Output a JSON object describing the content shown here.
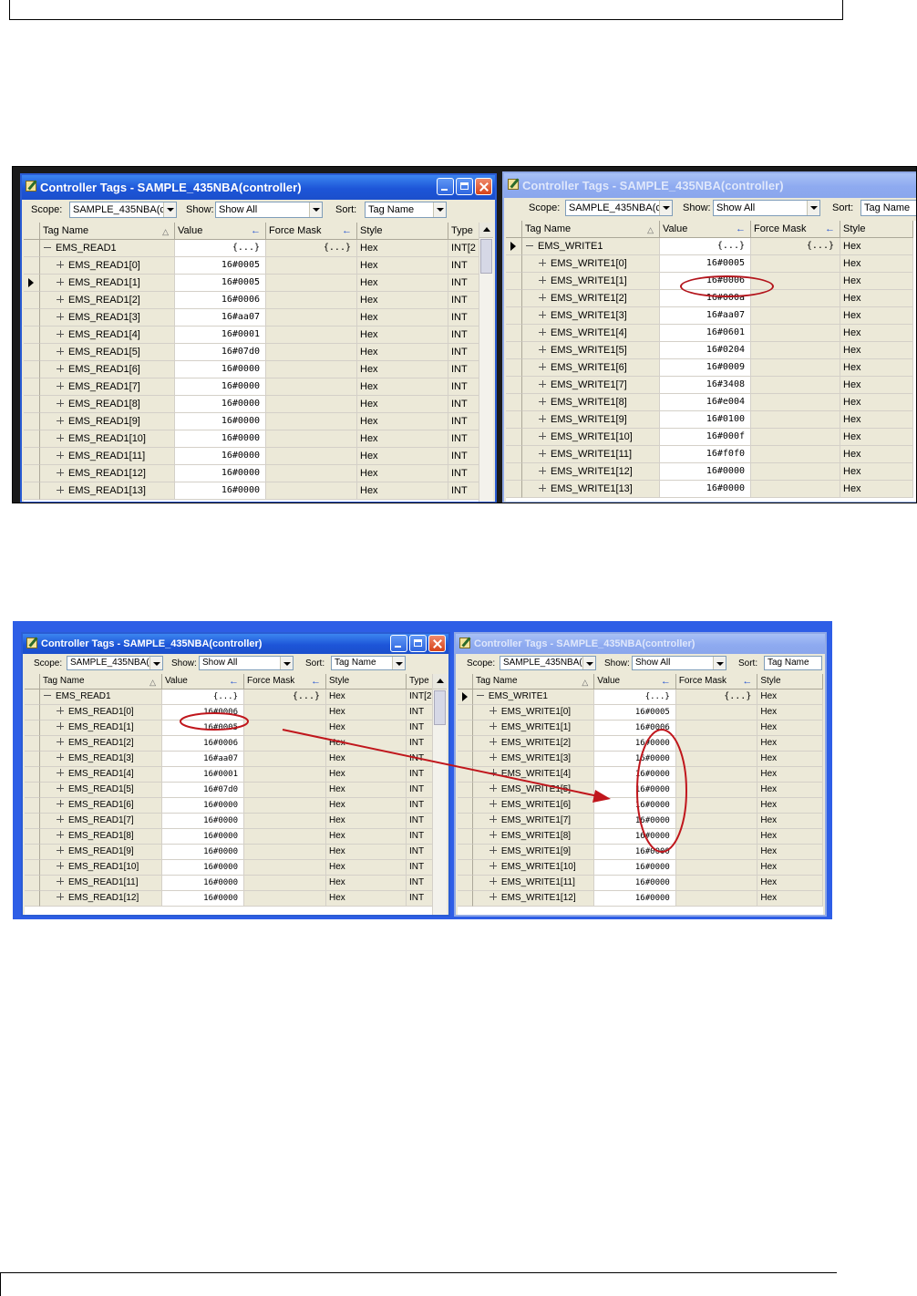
{
  "screens": [
    {
      "left_window": {
        "title": "Controller Tags - SAMPLE_435NBA(controller)",
        "toolbar": {
          "scope_label": "Scope:",
          "scope_value": "SAMPLE_435NBA(c",
          "show_label": "Show:",
          "show_value": "Show All",
          "sort_label": "Sort:",
          "sort_value": "Tag Name"
        },
        "columns": [
          "Tag Name",
          "Value",
          "Force Mask",
          "Style",
          "Type"
        ],
        "rows": [
          {
            "tag": "EMS_READ1",
            "value": "{...}",
            "force": "{...}",
            "style": "Hex",
            "type": "INT[2",
            "expanded": true
          },
          {
            "tag": "EMS_READ1[0]",
            "value": "16#0005",
            "force": "",
            "style": "Hex",
            "type": "INT"
          },
          {
            "tag": "EMS_READ1[1]",
            "value": "16#0005",
            "force": "",
            "style": "Hex",
            "type": "INT",
            "pointer": true
          },
          {
            "tag": "EMS_READ1[2]",
            "value": "16#0006",
            "force": "",
            "style": "Hex",
            "type": "INT"
          },
          {
            "tag": "EMS_READ1[3]",
            "value": "16#aa07",
            "force": "",
            "style": "Hex",
            "type": "INT"
          },
          {
            "tag": "EMS_READ1[4]",
            "value": "16#0001",
            "force": "",
            "style": "Hex",
            "type": "INT"
          },
          {
            "tag": "EMS_READ1[5]",
            "value": "16#07d0",
            "force": "",
            "style": "Hex",
            "type": "INT"
          },
          {
            "tag": "EMS_READ1[6]",
            "value": "16#0000",
            "force": "",
            "style": "Hex",
            "type": "INT"
          },
          {
            "tag": "EMS_READ1[7]",
            "value": "16#0000",
            "force": "",
            "style": "Hex",
            "type": "INT"
          },
          {
            "tag": "EMS_READ1[8]",
            "value": "16#0000",
            "force": "",
            "style": "Hex",
            "type": "INT"
          },
          {
            "tag": "EMS_READ1[9]",
            "value": "16#0000",
            "force": "",
            "style": "Hex",
            "type": "INT"
          },
          {
            "tag": "EMS_READ1[10]",
            "value": "16#0000",
            "force": "",
            "style": "Hex",
            "type": "INT"
          },
          {
            "tag": "EMS_READ1[11]",
            "value": "16#0000",
            "force": "",
            "style": "Hex",
            "type": "INT"
          },
          {
            "tag": "EMS_READ1[12]",
            "value": "16#0000",
            "force": "",
            "style": "Hex",
            "type": "INT"
          },
          {
            "tag": "EMS_READ1[13]",
            "value": "16#0000",
            "force": "",
            "style": "Hex",
            "type": "INT"
          }
        ]
      },
      "right_window": {
        "title": "Controller Tags - SAMPLE_435NBA(controller)",
        "toolbar": {
          "scope_label": "Scope:",
          "scope_value": "SAMPLE_435NBA(c",
          "show_label": "Show:",
          "show_value": "Show All",
          "sort_label": "Sort:",
          "sort_value": "Tag Name"
        },
        "columns": [
          "Tag Name",
          "Value",
          "Force Mask",
          "Style"
        ],
        "rows": [
          {
            "tag": "EMS_WRITE1",
            "value": "{...}",
            "force": "{...}",
            "style": "Hex",
            "expanded": true,
            "pointer": true
          },
          {
            "tag": "EMS_WRITE1[0]",
            "value": "16#0005",
            "force": "",
            "style": "Hex"
          },
          {
            "tag": "EMS_WRITE1[1]",
            "value": "16#0006",
            "force": "",
            "style": "Hex"
          },
          {
            "tag": "EMS_WRITE1[2]",
            "value": "16#000a",
            "force": "",
            "style": "Hex"
          },
          {
            "tag": "EMS_WRITE1[3]",
            "value": "16#aa07",
            "force": "",
            "style": "Hex"
          },
          {
            "tag": "EMS_WRITE1[4]",
            "value": "16#0601",
            "force": "",
            "style": "Hex"
          },
          {
            "tag": "EMS_WRITE1[5]",
            "value": "16#0204",
            "force": "",
            "style": "Hex"
          },
          {
            "tag": "EMS_WRITE1[6]",
            "value": "16#0009",
            "force": "",
            "style": "Hex"
          },
          {
            "tag": "EMS_WRITE1[7]",
            "value": "16#3408",
            "force": "",
            "style": "Hex"
          },
          {
            "tag": "EMS_WRITE1[8]",
            "value": "16#e004",
            "force": "",
            "style": "Hex"
          },
          {
            "tag": "EMS_WRITE1[9]",
            "value": "16#0100",
            "force": "",
            "style": "Hex"
          },
          {
            "tag": "EMS_WRITE1[10]",
            "value": "16#000f",
            "force": "",
            "style": "Hex"
          },
          {
            "tag": "EMS_WRITE1[11]",
            "value": "16#f0f0",
            "force": "",
            "style": "Hex"
          },
          {
            "tag": "EMS_WRITE1[12]",
            "value": "16#0000",
            "force": "",
            "style": "Hex"
          },
          {
            "tag": "EMS_WRITE1[13]",
            "value": "16#0000",
            "force": "",
            "style": "Hex"
          }
        ]
      }
    },
    {
      "left_window": {
        "title": "Controller Tags - SAMPLE_435NBA(controller)",
        "toolbar": {
          "scope_label": "Scope:",
          "scope_value": "SAMPLE_435NBA(c",
          "show_label": "Show:",
          "show_value": "Show All",
          "sort_label": "Sort:",
          "sort_value": "Tag Name"
        },
        "columns": [
          "Tag Name",
          "Value",
          "Force Mask",
          "Style",
          "Type"
        ],
        "rows": [
          {
            "tag": "EMS_READ1",
            "value": "{...}",
            "force": "{...}",
            "style": "Hex",
            "type": "INT[2",
            "expanded": true
          },
          {
            "tag": "EMS_READ1[0]",
            "value": "16#0006",
            "force": "",
            "style": "Hex",
            "type": "INT"
          },
          {
            "tag": "EMS_READ1[1]",
            "value": "16#0005",
            "force": "",
            "style": "Hex",
            "type": "INT"
          },
          {
            "tag": "EMS_READ1[2]",
            "value": "16#0006",
            "force": "",
            "style": "Hex",
            "type": "INT"
          },
          {
            "tag": "EMS_READ1[3]",
            "value": "16#aa07",
            "force": "",
            "style": "Hex",
            "type": "INT"
          },
          {
            "tag": "EMS_READ1[4]",
            "value": "16#0001",
            "force": "",
            "style": "Hex",
            "type": "INT"
          },
          {
            "tag": "EMS_READ1[5]",
            "value": "16#07d0",
            "force": "",
            "style": "Hex",
            "type": "INT"
          },
          {
            "tag": "EMS_READ1[6]",
            "value": "16#0000",
            "force": "",
            "style": "Hex",
            "type": "INT"
          },
          {
            "tag": "EMS_READ1[7]",
            "value": "16#0000",
            "force": "",
            "style": "Hex",
            "type": "INT"
          },
          {
            "tag": "EMS_READ1[8]",
            "value": "16#0000",
            "force": "",
            "style": "Hex",
            "type": "INT"
          },
          {
            "tag": "EMS_READ1[9]",
            "value": "16#0000",
            "force": "",
            "style": "Hex",
            "type": "INT"
          },
          {
            "tag": "EMS_READ1[10]",
            "value": "16#0000",
            "force": "",
            "style": "Hex",
            "type": "INT"
          },
          {
            "tag": "EMS_READ1[11]",
            "value": "16#0000",
            "force": "",
            "style": "Hex",
            "type": "INT"
          },
          {
            "tag": "EMS_READ1[12]",
            "value": "16#0000",
            "force": "",
            "style": "Hex",
            "type": "INT"
          }
        ]
      },
      "right_window": {
        "title": "Controller Tags - SAMPLE_435NBA(controller)",
        "toolbar": {
          "scope_label": "Scope:",
          "scope_value": "SAMPLE_435NBA(c",
          "show_label": "Show:",
          "show_value": "Show All",
          "sort_label": "Sort:",
          "sort_value": "Tag Name"
        },
        "columns": [
          "Tag Name",
          "Value",
          "Force Mask",
          "Style"
        ],
        "rows": [
          {
            "tag": "EMS_WRITE1",
            "value": "{...}",
            "force": "{...}",
            "style": "Hex",
            "expanded": true,
            "pointer": true
          },
          {
            "tag": "EMS_WRITE1[0]",
            "value": "16#0005",
            "force": "",
            "style": "Hex"
          },
          {
            "tag": "EMS_WRITE1[1]",
            "value": "16#0006",
            "force": "",
            "style": "Hex"
          },
          {
            "tag": "EMS_WRITE1[2]",
            "value": "16#0000",
            "force": "",
            "style": "Hex"
          },
          {
            "tag": "EMS_WRITE1[3]",
            "value": "16#0000",
            "force": "",
            "style": "Hex"
          },
          {
            "tag": "EMS_WRITE1[4]",
            "value": "16#0000",
            "force": "",
            "style": "Hex"
          },
          {
            "tag": "EMS_WRITE1[5]",
            "value": "16#0000",
            "force": "",
            "style": "Hex"
          },
          {
            "tag": "EMS_WRITE1[6]",
            "value": "16#0000",
            "force": "",
            "style": "Hex"
          },
          {
            "tag": "EMS_WRITE1[7]",
            "value": "16#0000",
            "force": "",
            "style": "Hex"
          },
          {
            "tag": "EMS_WRITE1[8]",
            "value": "16#0000",
            "force": "",
            "style": "Hex"
          },
          {
            "tag": "EMS_WRITE1[9]",
            "value": "16#0000",
            "force": "",
            "style": "Hex"
          },
          {
            "tag": "EMS_WRITE1[10]",
            "value": "16#0000",
            "force": "",
            "style": "Hex"
          },
          {
            "tag": "EMS_WRITE1[11]",
            "value": "16#0000",
            "force": "",
            "style": "Hex"
          },
          {
            "tag": "EMS_WRITE1[12]",
            "value": "16#0000",
            "force": "",
            "style": "Hex"
          }
        ]
      }
    }
  ],
  "colors": {
    "annotation": "#c0161c",
    "active_title": "#1d55d8",
    "inactive_title": "#8eaaf0"
  }
}
